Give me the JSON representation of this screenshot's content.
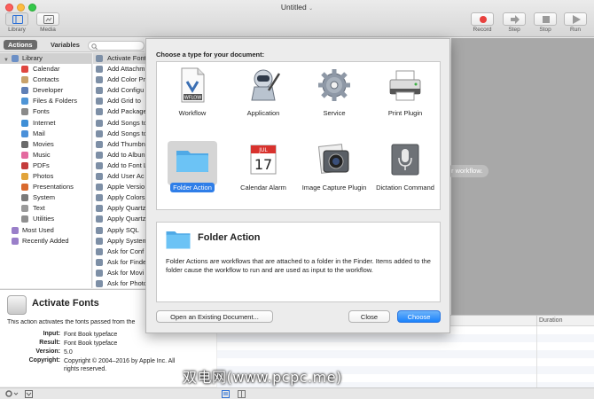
{
  "window": {
    "title": "Untitled",
    "title_suffix": "⌄"
  },
  "toolbar": {
    "library_label": "Library",
    "media_label": "Media",
    "record_label": "Record",
    "step_label": "Step",
    "stop_label": "Stop",
    "run_label": "Run"
  },
  "library": {
    "tab_actions": "Actions",
    "tab_variables": "Variables",
    "root_label": "Library",
    "categories": [
      "Calendar",
      "Contacts",
      "Developer",
      "Files & Folders",
      "Fonts",
      "Internet",
      "Mail",
      "Movies",
      "Music",
      "PDFs",
      "Photos",
      "Presentations",
      "System",
      "Text",
      "Utilities"
    ],
    "most_used": "Most Used",
    "recently_added": "Recently Added"
  },
  "actions": [
    "Activate Fonts",
    "Add Attachm",
    "Add Color Pr",
    "Add Configu",
    "Add Grid to",
    "Add Package",
    "Add Songs to",
    "Add Songs to",
    "Add Thumbn",
    "Add to Albun",
    "Add to Font L",
    "Add User Ac",
    "Apple Versio",
    "Apply Colors",
    "Apply Quartz",
    "Apply Quartz",
    "Apply SQL",
    "Apply System",
    "Ask for Conf",
    "Ask for Finde",
    "Ask for Movi",
    "Ask for Photo"
  ],
  "description": {
    "title": "Activate Fonts",
    "text": "This action activates the fonts passed from the",
    "input_key": "Input:",
    "input_val": "Font Book typeface",
    "result_key": "Result:",
    "result_val": "Font Book typeface",
    "version_key": "Version:",
    "version_val": "5.0",
    "copyright_key": "Copyright:",
    "copyright_val": "Copyright © 2004–2016 by Apple Inc. All rights reserved."
  },
  "workflow": {
    "hint": "r workflow."
  },
  "log": {
    "duration_header": "Duration"
  },
  "sheet": {
    "prompt": "Choose a type for your document:",
    "types": [
      {
        "label": "Workflow"
      },
      {
        "label": "Application"
      },
      {
        "label": "Service"
      },
      {
        "label": "Print Plugin"
      },
      {
        "label": "Folder Action"
      },
      {
        "label": "Calendar Alarm"
      },
      {
        "label": "Image Capture Plugin"
      },
      {
        "label": "Dictation Command"
      }
    ],
    "wflow_badge": "WFLOW",
    "calendar_month": "JUL",
    "calendar_day": "17",
    "selected_title": "Folder Action",
    "selected_text": "Folder Actions are workflows that are attached to a folder in the Finder. Items added to the folder cause the workflow to run and are used as input to the workflow.",
    "open_button": "Open an Existing Document...",
    "close_button": "Close",
    "choose_button": "Choose"
  },
  "watermark": "双电网(www.pcpc.me)",
  "colors": {
    "accent": "#1a82fb",
    "record": "#e8413e",
    "folder": "#5ab8f0"
  }
}
